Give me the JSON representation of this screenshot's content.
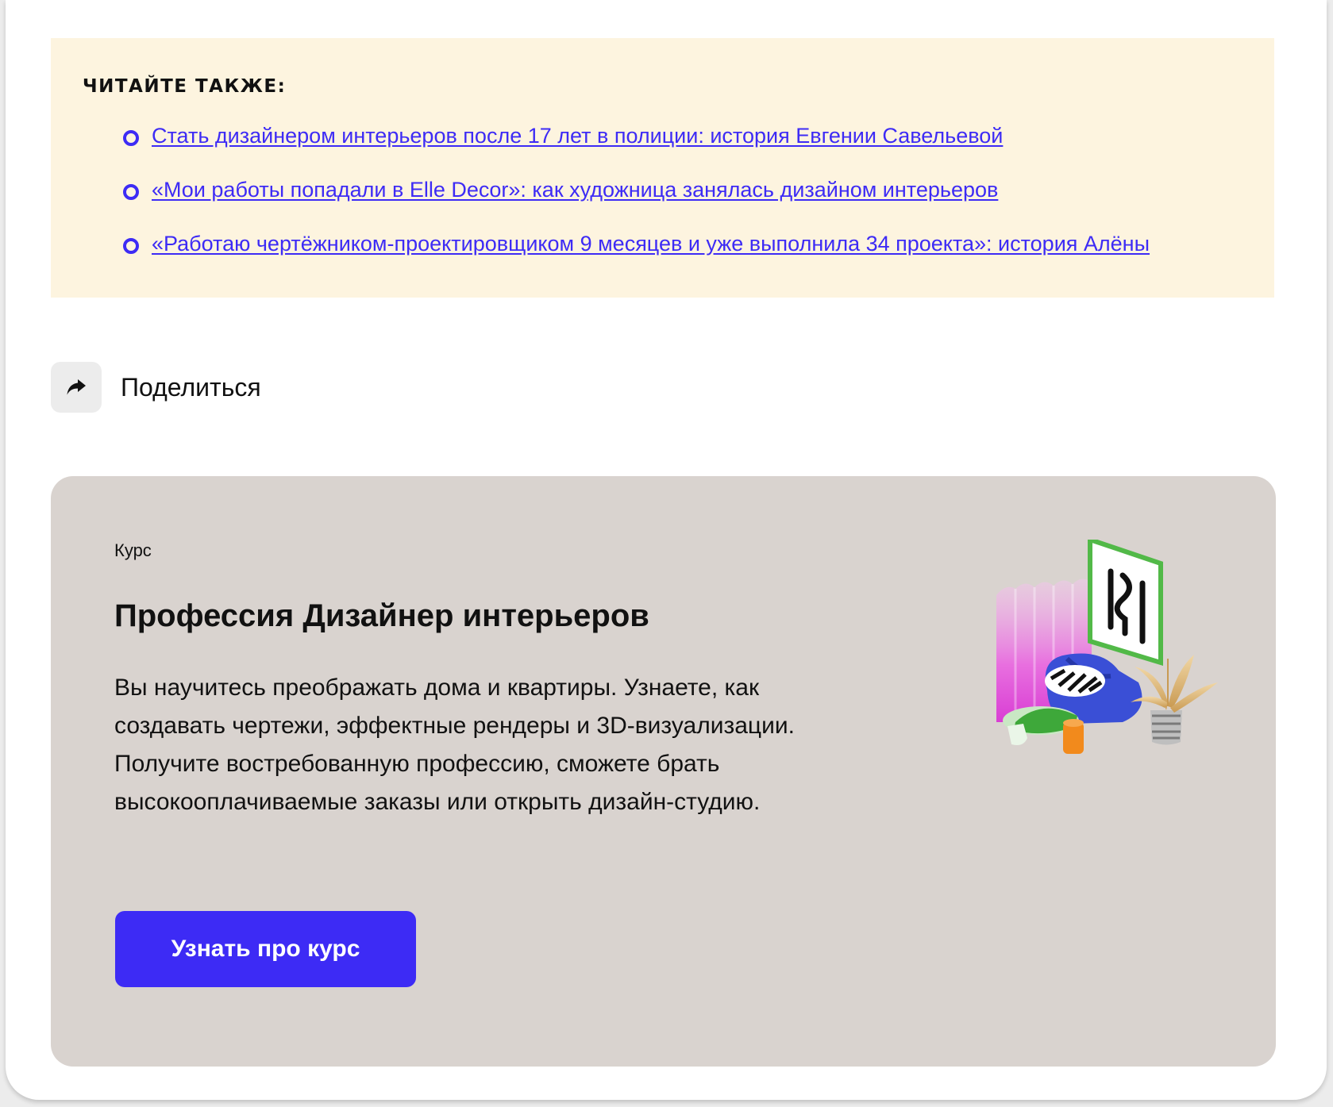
{
  "read_also": {
    "title": "ЧИТАЙТЕ ТАКЖЕ:",
    "links": [
      "Стать дизайнером интерьеров после 17 лет в полиции: история Евгении Савельевой",
      "«Мои работы попадали в Elle Decor»: как художница занялась дизайном интерьеров",
      "«Работаю чертёжником-проектировщиком 9 месяцев и уже выполнила 34 проекта»: история Алёны"
    ]
  },
  "share": {
    "icon": "share-arrow-icon",
    "label": "Поделиться"
  },
  "course": {
    "kicker": "Курс",
    "title": "Профессия Дизайнер интерьеров",
    "description": "Вы научитесь преображать дома и квартиры. Узнаете, как создавать чертежи, эффектные рендеры и 3D-визуализации. Получите востребованную профессию, сможете брать высокооплачиваемые заказы или открыть дизайн-студию.",
    "cta_label": "Узнать про курс",
    "illustration": "interior-3d-illustration"
  },
  "colors": {
    "accent": "#3d2bf5",
    "read_also_bg": "#fdf4df",
    "course_card_bg": "#d9d3cf",
    "share_button_bg": "#ececec"
  }
}
